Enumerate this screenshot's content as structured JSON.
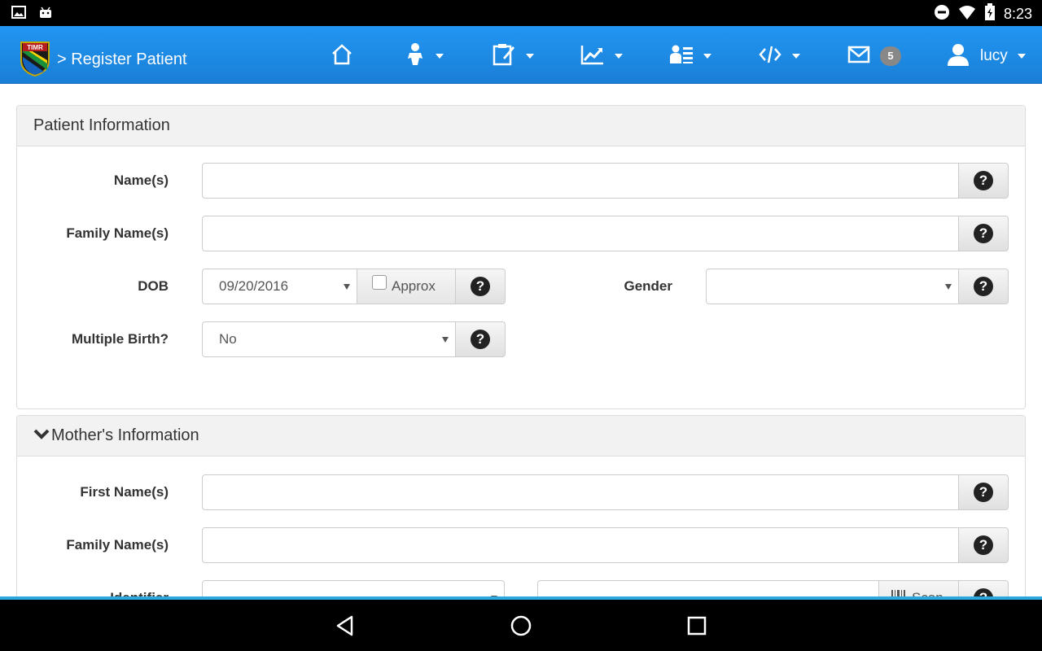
{
  "status_bar": {
    "time": "8:23",
    "left_icons": [
      "image-icon",
      "android-icon"
    ],
    "right_icons": [
      "do-not-disturb-icon",
      "wifi-icon",
      "battery-charging-icon"
    ]
  },
  "navbar": {
    "logo_text": "TIMR",
    "breadcrumb": "> Register Patient",
    "icons": [
      "home-icon",
      "baby-icon",
      "clipboard-edit-icon",
      "chart-trend-icon",
      "patient-list-icon",
      "code-icon",
      "mail-icon",
      "user-icon"
    ],
    "mail_badge": "5",
    "user_name": "lucy",
    "accent_color": "#2196f3"
  },
  "patient_panel": {
    "title": "Patient Information",
    "fields": {
      "names_label": "Name(s)",
      "names_value": "",
      "family_names_label": "Family Name(s)",
      "family_names_value": "",
      "dob_label": "DOB",
      "dob_value": "09/20/2016",
      "approx_label": "Approx",
      "approx_checked": false,
      "gender_label": "Gender",
      "gender_value": "",
      "multiple_birth_label": "Multiple Birth?",
      "multiple_birth_value": "No"
    }
  },
  "mother_panel": {
    "title": "Mother's Information",
    "fields": {
      "first_names_label": "First Name(s)",
      "first_names_value": "",
      "family_names_label": "Family Name(s)",
      "family_names_value": "",
      "identifier_label": "Identifier",
      "scan_label": "Scan"
    }
  },
  "system_nav": [
    "back-icon",
    "home-circle-icon",
    "recents-icon"
  ]
}
